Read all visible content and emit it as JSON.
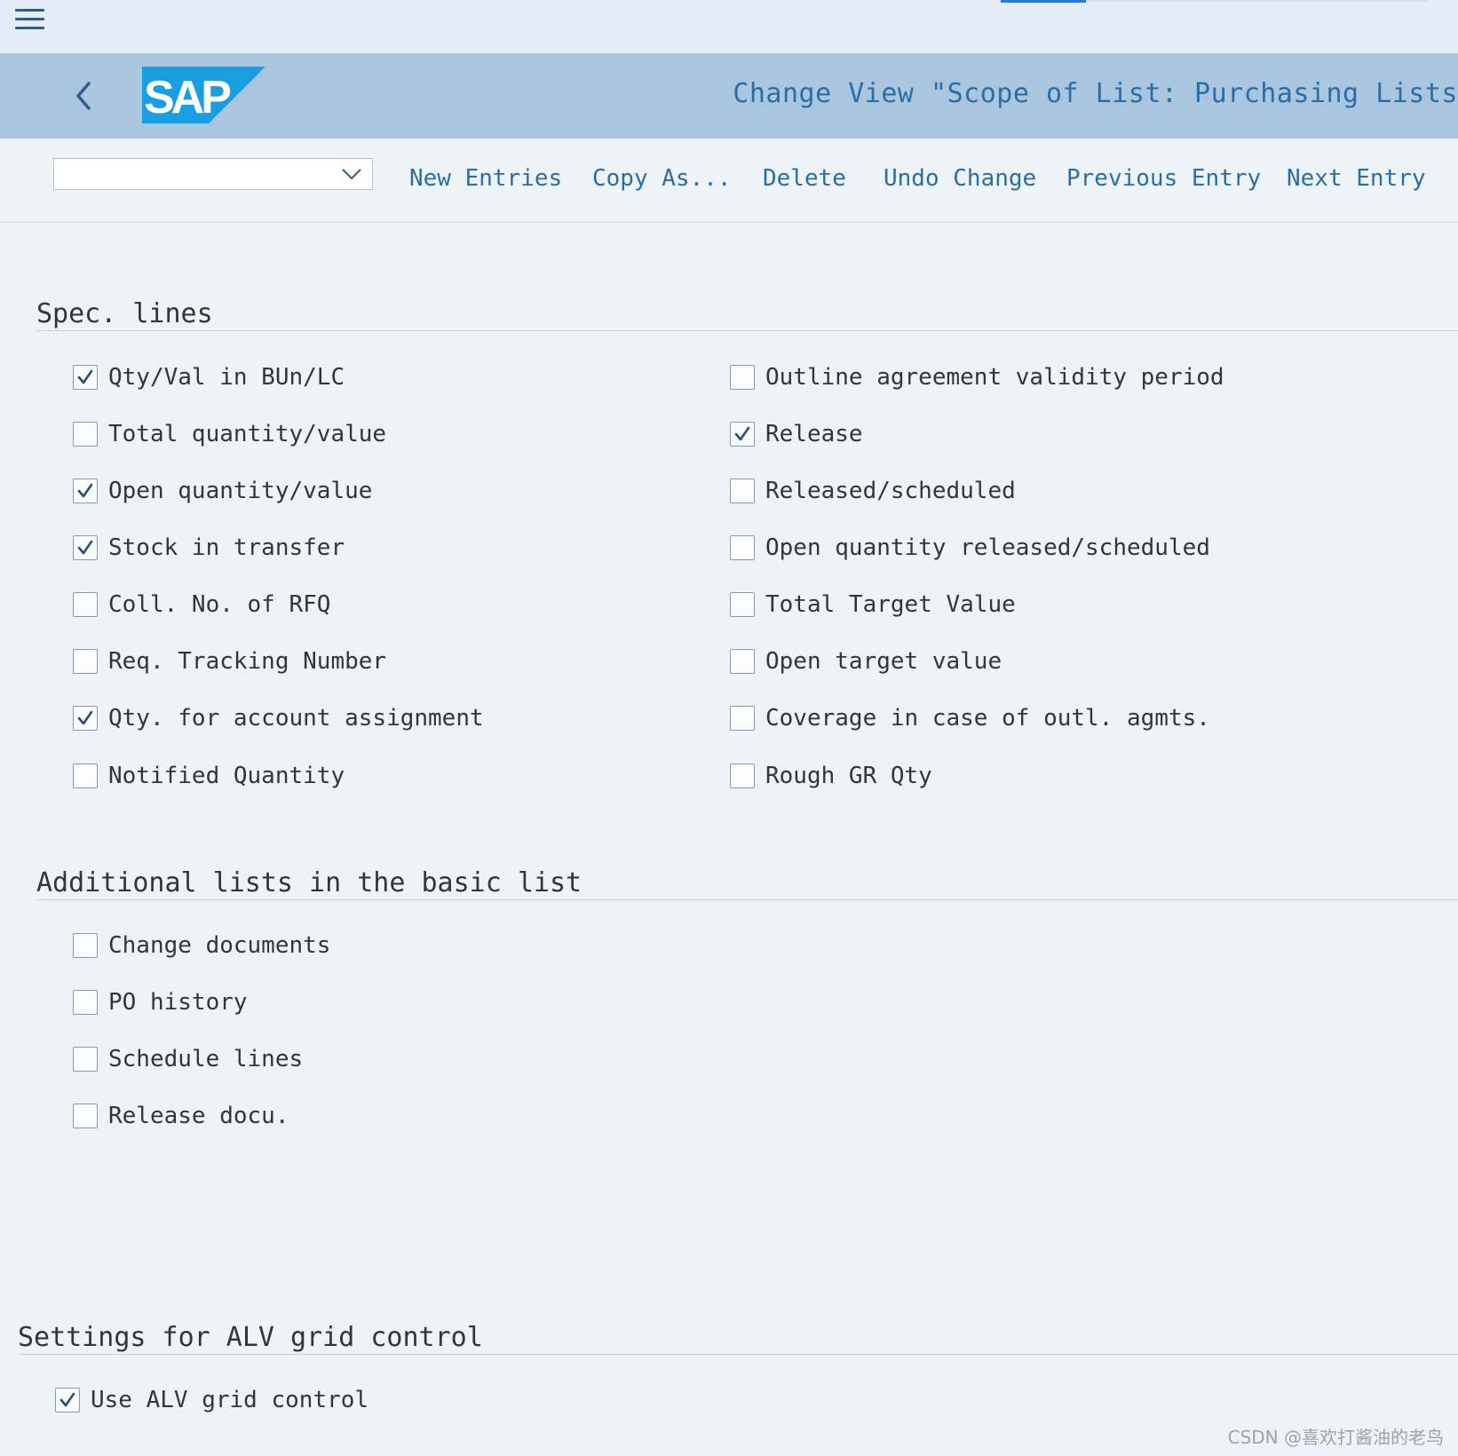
{
  "header": {
    "title": "Change View \"Scope of List: Purchasing Lists"
  },
  "toolbar": {
    "select_value": "",
    "buttons": [
      "New Entries",
      "Copy As...",
      "Delete",
      "Undo Change",
      "Previous Entry",
      "Next Entry"
    ]
  },
  "sections": {
    "spec_lines": {
      "title": "Spec. lines",
      "left": [
        {
          "label": "Qty/Val in BUn/LC",
          "checked": true
        },
        {
          "label": "Total quantity/value",
          "checked": false
        },
        {
          "label": "Open quantity/value",
          "checked": true
        },
        {
          "label": "Stock in transfer",
          "checked": true
        },
        {
          "label": "Coll. No. of RFQ",
          "checked": false
        },
        {
          "label": "Req. Tracking Number",
          "checked": false
        },
        {
          "label": "Qty. for account assignment",
          "checked": true
        },
        {
          "label": "Notified Quantity",
          "checked": false
        }
      ],
      "right": [
        {
          "label": "Outline agreement validity period",
          "checked": false
        },
        {
          "label": "Release",
          "checked": true
        },
        {
          "label": "Released/scheduled",
          "checked": false
        },
        {
          "label": "Open quantity released/scheduled",
          "checked": false
        },
        {
          "label": "Total Target Value",
          "checked": false
        },
        {
          "label": "Open target value",
          "checked": false
        },
        {
          "label": "Coverage in case of outl. agmts.",
          "checked": false
        },
        {
          "label": "Rough GR Qty",
          "checked": false
        }
      ]
    },
    "additional_lists": {
      "title": "Additional lists in the basic list",
      "items": [
        {
          "label": "Change documents",
          "checked": false
        },
        {
          "label": "PO history",
          "checked": false
        },
        {
          "label": "Schedule lines",
          "checked": false
        },
        {
          "label": "Release docu.",
          "checked": false
        }
      ]
    },
    "alv_settings": {
      "title": "Settings for ALV grid control",
      "items": [
        {
          "label": "Use ALV grid control",
          "checked": true
        }
      ]
    }
  },
  "watermark": "CSDN @喜欢打酱油的老鸟",
  "colors": {
    "header_bg": "#aac5de",
    "page_bg": "#eef3f8",
    "link": "#2a6ea6",
    "sap_blue": "#1a9ee2",
    "check": "#2b4d6e"
  }
}
